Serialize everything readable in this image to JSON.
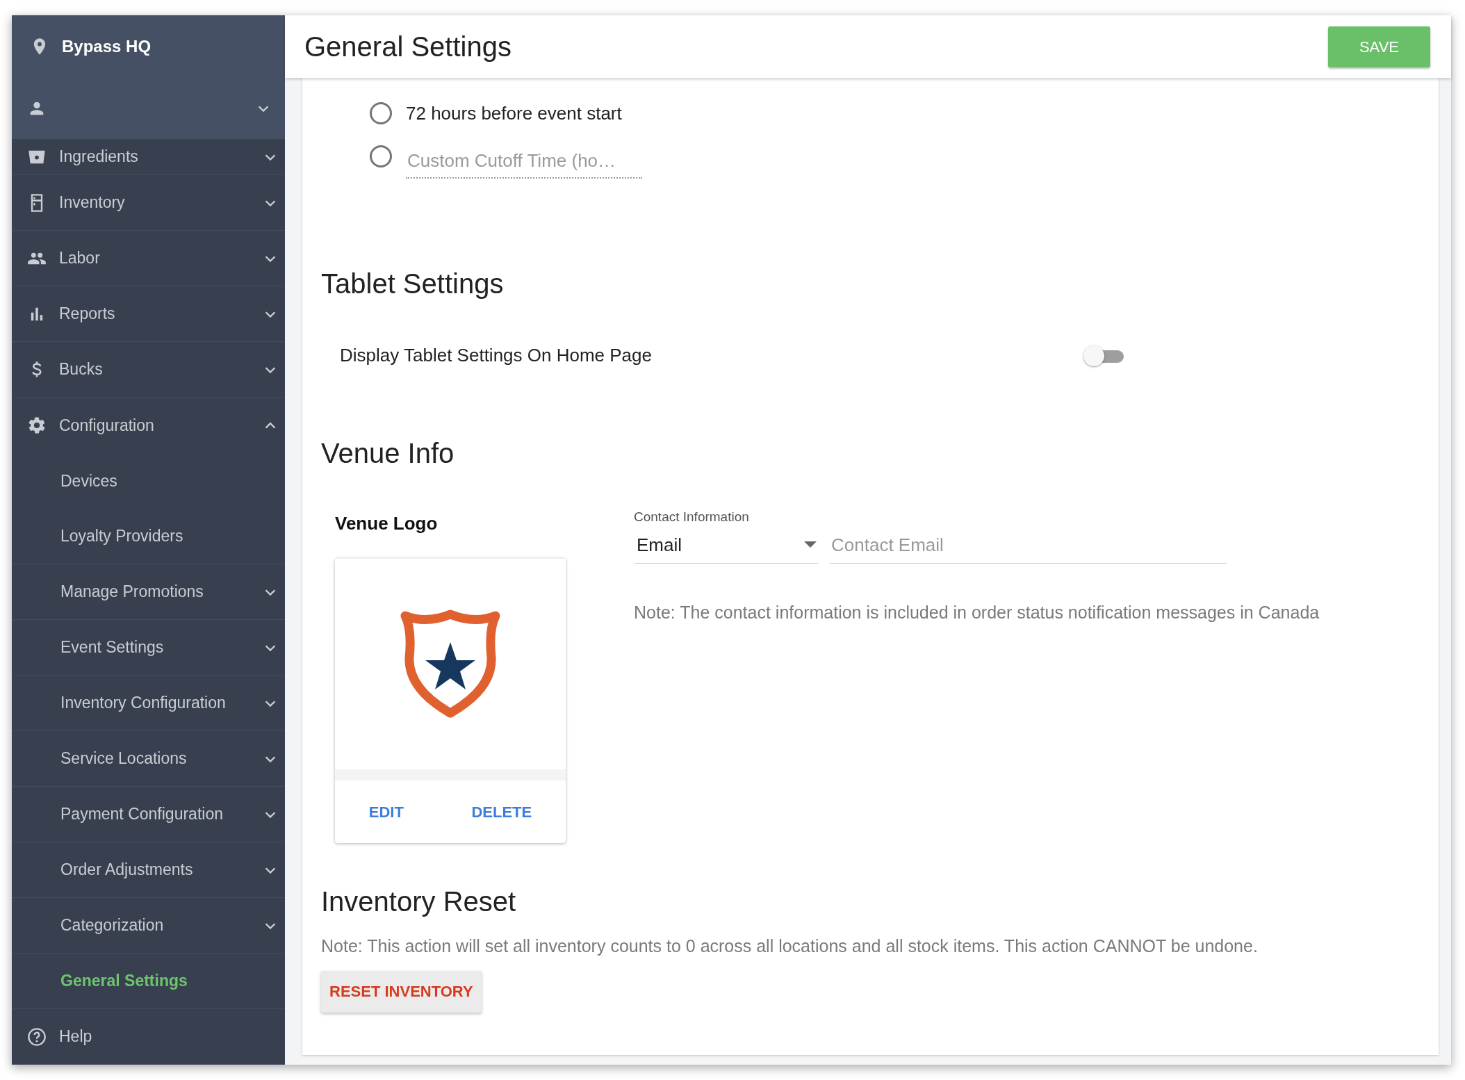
{
  "sidebar": {
    "venue": "Bypass HQ",
    "user_menu": {
      "expanded": false
    },
    "items": [
      {
        "label": "Ingredients",
        "expanded": false
      },
      {
        "label": "Inventory",
        "expanded": false
      },
      {
        "label": "Labor",
        "expanded": false
      },
      {
        "label": "Reports",
        "expanded": false
      },
      {
        "label": "Bucks",
        "expanded": false
      },
      {
        "label": "Configuration",
        "expanded": true,
        "children": [
          {
            "label": "Devices",
            "selected": false
          },
          {
            "label": "Loyalty Providers",
            "selected": false
          },
          {
            "label": "Manage Promotions",
            "selected": false,
            "expanded": false
          },
          {
            "label": "Event Settings",
            "selected": false,
            "expanded": false
          },
          {
            "label": "Inventory Configuration",
            "selected": false,
            "expanded": false
          },
          {
            "label": "Service Locations",
            "selected": false,
            "expanded": false
          },
          {
            "label": "Payment Configuration",
            "selected": false,
            "expanded": false
          },
          {
            "label": "Order Adjustments",
            "selected": false,
            "expanded": false
          },
          {
            "label": "Categorization",
            "selected": false,
            "expanded": false
          },
          {
            "label": "General Settings",
            "selected": true
          }
        ]
      },
      {
        "label": "Help"
      }
    ]
  },
  "header": {
    "title": "General Settings",
    "save_button": "SAVE"
  },
  "cutoff_options": [
    {
      "kind": "label",
      "label": "72 hours before event start",
      "selected": false
    },
    {
      "kind": "input",
      "placeholder": "Custom Cutoff Time (ho…",
      "selected": false
    }
  ],
  "tablet_settings": {
    "heading": "Tablet Settings",
    "label": "Display Tablet Settings On Home Page",
    "on": false
  },
  "venue_info": {
    "heading": "Venue Info",
    "logo_label": "Venue Logo",
    "logo_actions": [
      "EDIT",
      "DELETE"
    ],
    "contact_label": "Contact Information",
    "contact_type": "Email",
    "contact_placeholder": "Contact Email",
    "note": "Note: The contact information is included in order status notification messages in Canada"
  },
  "inventory_reset": {
    "heading": "Inventory Reset",
    "note": "Note: This action will set all inventory counts to 0 across all locations and all stock items. This action CANNOT be undone.",
    "button": "RESET INVENTORY"
  }
}
